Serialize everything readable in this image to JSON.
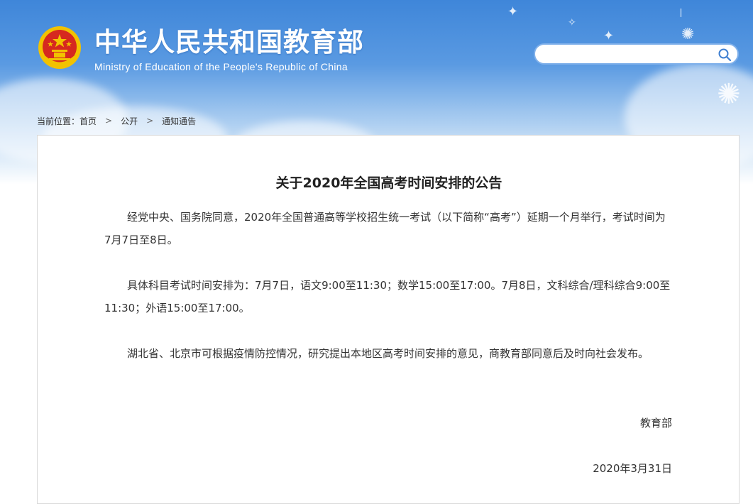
{
  "header": {
    "site_title": "中华人民共和国教育部",
    "site_subtitle": "Ministry of Education of the People's Republic of China",
    "emblem_icon": "national-emblem-icon",
    "search": {
      "value": "",
      "placeholder": "",
      "icon": "search-icon"
    }
  },
  "breadcrumb": {
    "prefix": "当前位置：",
    "items": [
      "首页",
      "公开",
      "通知通告"
    ],
    "separator": ">"
  },
  "article": {
    "title": "关于2020年全国高考时间安排的公告",
    "paragraphs": [
      "经党中央、国务院同意，2020年全国普通高等学校招生统一考试（以下简称“高考”）延期一个月举行，考试时间为7月7日至8日。",
      "具体科目考试时间安排为：7月7日，语文9:00至11:30；数学15:00至17:00。7月8日，文科综合/理科综合9:00至11:30；外语15:00至17:00。",
      "湖北省、北京市可根据疫情防控情况，研究提出本地区高考时间安排的意见，商教育部同意后及时向社会发布。"
    ],
    "signature": "教育部",
    "date": "2020年3月31日"
  },
  "colors": {
    "header_blue": "#3f86d9",
    "emblem_red": "#d6281f",
    "emblem_gold": "#f2c200"
  }
}
